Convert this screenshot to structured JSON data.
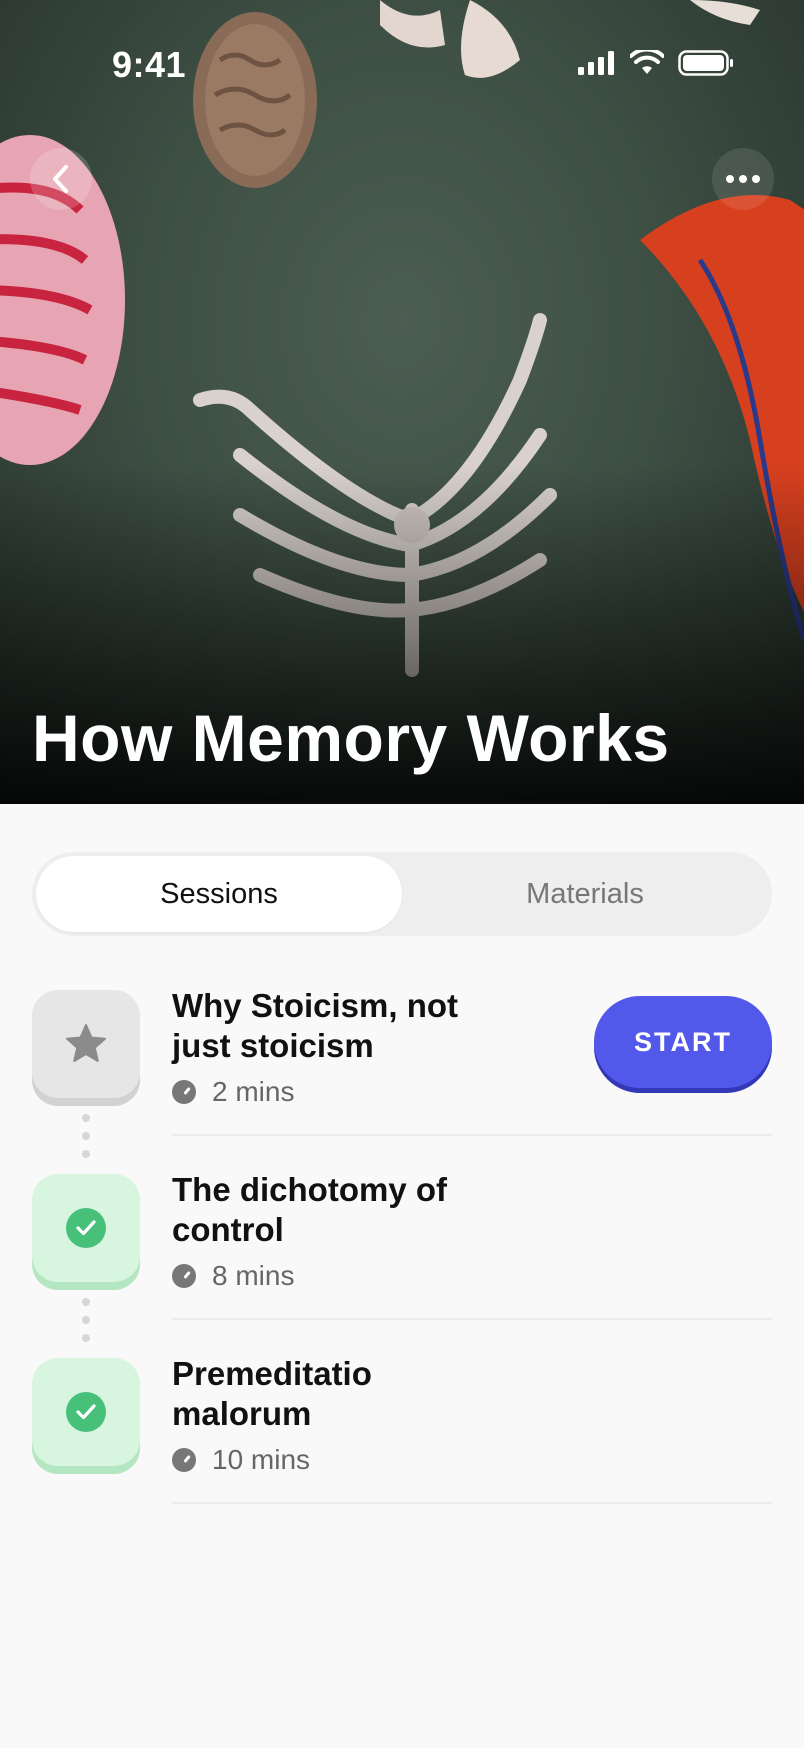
{
  "status_bar": {
    "time": "9:41"
  },
  "hero": {
    "title": "How Memory Works"
  },
  "tabs": [
    {
      "label": "Sessions",
      "active": true
    },
    {
      "label": "Materials",
      "active": false
    }
  ],
  "sessions": [
    {
      "title": "Why Stoicism, not just stoicism",
      "duration": "2 mins",
      "state": "locked",
      "action_label": "START"
    },
    {
      "title": "The dichotomy of control",
      "duration": "8 mins",
      "state": "completed"
    },
    {
      "title": "Premeditatio malorum",
      "duration": "10 mins",
      "state": "completed"
    }
  ],
  "colors": {
    "accent": "#5158EA",
    "completed": "#47C07A",
    "completed_bg": "#D8F5DF",
    "locked_bg": "#E6E6E6"
  },
  "icons": {
    "back": "chevron-left-icon",
    "more": "more-horizontal-icon",
    "locked_session": "star-icon",
    "completed_session": "check-icon",
    "duration": "clock-icon"
  }
}
